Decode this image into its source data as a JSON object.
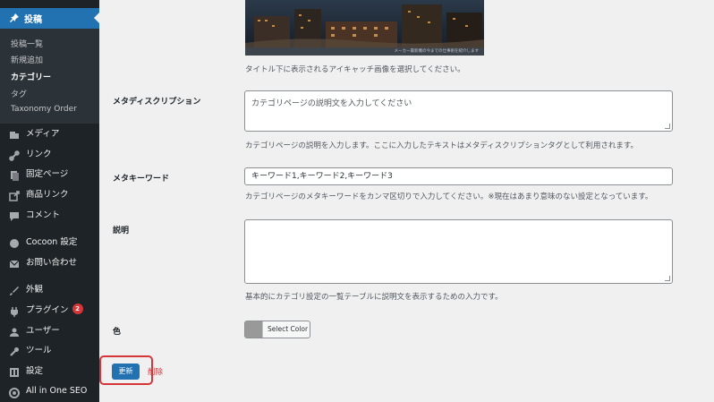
{
  "sidebar": {
    "active": {
      "label": "投稿",
      "icon": "pin-icon"
    },
    "submenu": [
      {
        "label": "投稿一覧",
        "current": false
      },
      {
        "label": "新規追加",
        "current": false
      },
      {
        "label": "カテゴリー",
        "current": true
      },
      {
        "label": "タグ",
        "current": false
      },
      {
        "label": "Taxonomy Order",
        "current": false
      }
    ],
    "items": [
      {
        "label": "メディア",
        "icon": "media-icon"
      },
      {
        "label": "リンク",
        "icon": "link-icon"
      },
      {
        "label": "固定ページ",
        "icon": "pages-icon"
      },
      {
        "label": "商品リンク",
        "icon": "external-link-icon"
      },
      {
        "label": "コメント",
        "icon": "comment-icon"
      },
      {
        "label": "Cocoon 設定",
        "icon": "cocoon-icon"
      },
      {
        "label": "お問い合わせ",
        "icon": "mail-icon"
      },
      {
        "label": "外観",
        "icon": "brush-icon"
      },
      {
        "label": "プラグイン",
        "icon": "plugin-icon",
        "badge": "2"
      },
      {
        "label": "ユーザー",
        "icon": "user-icon"
      },
      {
        "label": "ツール",
        "icon": "wrench-icon"
      },
      {
        "label": "設定",
        "icon": "settings-icon"
      },
      {
        "label": "All in One SEO",
        "icon": "aioseo-icon"
      }
    ]
  },
  "form": {
    "eyecatch_caption": "メーカー最新機の今までの仕事術を紹介します",
    "eyecatch_desc": "タイトル下に表示されるアイキャッチ画像を選択してください。",
    "meta_description": {
      "label": "メタディスクリプション",
      "placeholder": "カテゴリページの説明文を入力してください",
      "desc": "カテゴリページの説明を入力します。ここに入力したテキストはメタディスクリプションタグとして利用されます。"
    },
    "meta_keywords": {
      "label": "メタキーワード",
      "placeholder": "キーワード1,キーワード2,キーワード3",
      "desc": "カテゴリページのメタキーワードをカンマ区切りで入力してください。※現在はあまり意味のない設定となっています。"
    },
    "description": {
      "label": "説明",
      "desc": "基本的にカテゴリ設定の一覧テーブルに説明文を表示するための入力です。"
    },
    "color": {
      "label": "色",
      "button": "Select Color",
      "swatch": "#999999"
    },
    "update_button": "更新",
    "delete_link": "削除"
  },
  "colors": {
    "sidebar_bg": "#1d2327",
    "accent": "#2271b1",
    "danger": "#d63638"
  }
}
